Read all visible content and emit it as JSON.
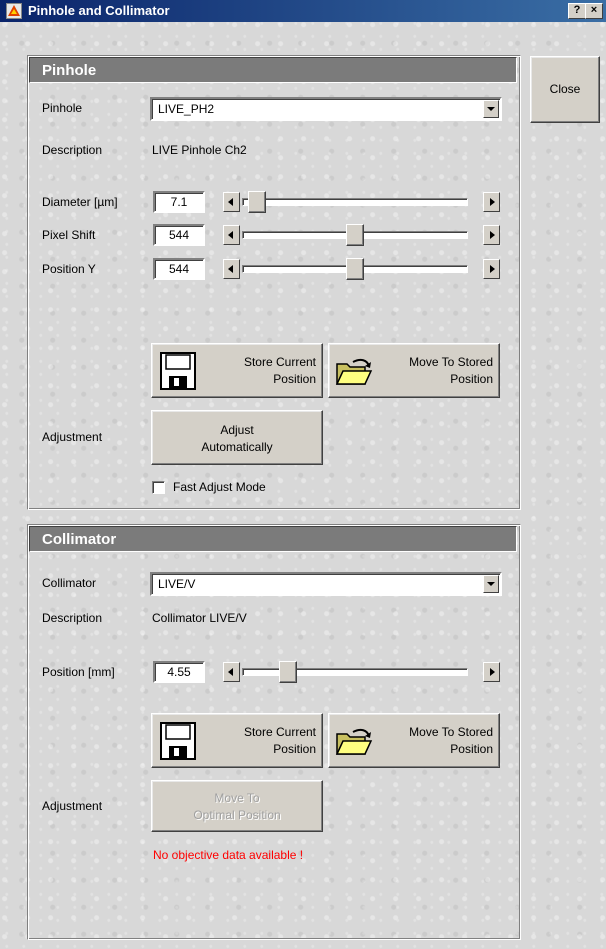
{
  "window": {
    "title": "Pinhole and Collimator",
    "help_label": "?",
    "close_label": "×"
  },
  "close_button": {
    "label": "Close"
  },
  "pinhole": {
    "section_title": "Pinhole",
    "selector_label": "Pinhole",
    "selector_value": "LIVE_PH2",
    "description_label": "Description",
    "description_value": "LIVE Pinhole Ch2",
    "diameter": {
      "label": "Diameter [µm]",
      "value": "7.1",
      "slider_fraction": 0.02
    },
    "pixel_shift": {
      "label": "Pixel Shift",
      "value": "544",
      "slider_fraction": 0.5
    },
    "position_y": {
      "label": "Position Y",
      "value": "544",
      "slider_fraction": 0.5
    },
    "store_button": {
      "line1": "Store Current",
      "line2": "Position",
      "icon": "floppy-disk-icon"
    },
    "move_button": {
      "line1": "Move To Stored",
      "line2": "Position",
      "icon": "folder-arrow-icon"
    },
    "adjustment_label": "Adjustment",
    "adjust_button": {
      "line1": "Adjust",
      "line2": "Automatically"
    },
    "fast_adjust": {
      "label": "Fast Adjust Mode",
      "checked": false
    }
  },
  "collimator": {
    "section_title": "Collimator",
    "selector_label": "Collimator",
    "selector_value": "LIVE/V",
    "description_label": "Description",
    "description_value": "Collimator LIVE/V",
    "position": {
      "label": "Position [mm]",
      "value": "4.55",
      "slider_fraction": 0.17
    },
    "store_button": {
      "line1": "Store Current",
      "line2": "Position",
      "icon": "floppy-disk-icon"
    },
    "move_button": {
      "line1": "Move To Stored",
      "line2": "Position",
      "icon": "folder-arrow-icon"
    },
    "adjustment_label": "Adjustment",
    "optimal_button": {
      "line1": "Move To",
      "line2": "Optimal Position",
      "disabled": true
    },
    "error_text": "No objective data available !"
  },
  "colors": {
    "title_bar": "#0a246a",
    "section_header": "#7b7b7b",
    "error": "#ff0000"
  }
}
